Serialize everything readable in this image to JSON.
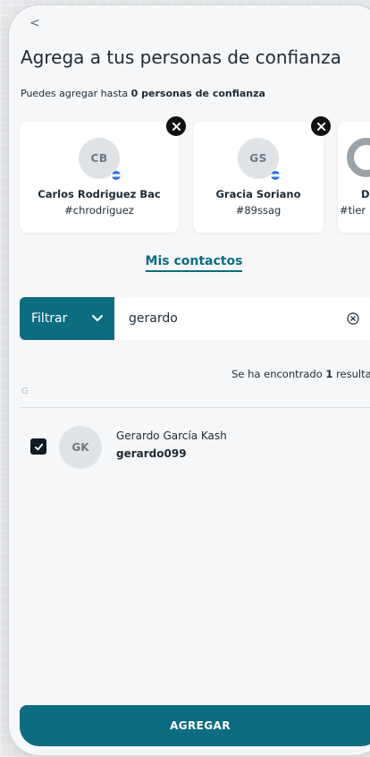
{
  "header": {
    "back_glyph": "<",
    "title": "Agrega a tus personas de confianza",
    "subtitle_prefix": "Puedes agregar hasta ",
    "subtitle_bold": "0 personas de confianza"
  },
  "trusted": [
    {
      "initials": "CB",
      "name": "Carlos Rodriguez Bac",
      "handle": "#chrodriguez"
    },
    {
      "initials": "GS",
      "name": "Gracia Soriano",
      "handle": "#89ssag"
    },
    {
      "initials": "",
      "name": "Da",
      "handle": "#tier"
    }
  ],
  "contacts_link": "Mis contactos",
  "search": {
    "filter_label": "Filtrar",
    "query": "gerardo"
  },
  "results": {
    "prefix": "Se ha encontrado ",
    "count": "1",
    "suffix": " resultado",
    "section_letter": "G"
  },
  "contacts": [
    {
      "initials": "GK",
      "name": "Gerardo García Kash",
      "username": "gerardo099",
      "checked": true
    }
  ],
  "actions": {
    "add_label": "AGREGAR"
  },
  "colors": {
    "primary": "#0d6d80",
    "background": "#f6f7f8",
    "avatar_bg": "#dfe3e6"
  }
}
